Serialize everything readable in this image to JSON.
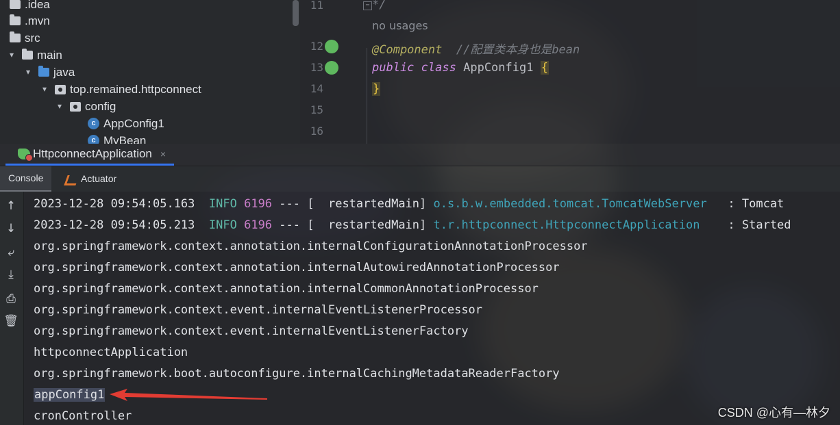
{
  "project_tree": {
    "items": [
      {
        "label": ".idea",
        "type": "folder"
      },
      {
        "label": ".mvn",
        "type": "folder"
      },
      {
        "label": "src",
        "type": "folder"
      },
      {
        "label": "main",
        "type": "folder"
      },
      {
        "label": "java",
        "type": "source-folder"
      },
      {
        "label": "top.remained.httpconnect",
        "type": "package"
      },
      {
        "label": "config",
        "type": "package"
      },
      {
        "label": "AppConfig1",
        "type": "class"
      },
      {
        "label": "MyBean",
        "type": "class"
      }
    ],
    "class_icon_glyph": "c"
  },
  "editor": {
    "line_numbers": [
      "11",
      "12",
      "13",
      "14",
      "15",
      "16"
    ],
    "comment_end": "*/",
    "usages_hint": "no usages",
    "annotation": "@Component",
    "annotation_comment": "//配置类本身也是bean",
    "kw_public": "public",
    "kw_class": "class",
    "class_name": "AppConfig1",
    "open_brace": "{",
    "close_brace": "}"
  },
  "run_panel": {
    "run_tab_label": "HttpconnectApplication",
    "close_glyph": "×",
    "sub_tabs": {
      "console": "Console",
      "actuator": "Actuator"
    }
  },
  "console": {
    "log_entries": [
      {
        "timestamp": "2023-12-28 09:54:05.163",
        "level": "INFO",
        "pid": "6196",
        "separator": "---",
        "thread": "[  restartedMain]",
        "logger": "o.s.b.w.embedded.tomcat.TomcatWebServer",
        "message": "  : Tomcat"
      },
      {
        "timestamp": "2023-12-28 09:54:05.213",
        "level": "INFO",
        "pid": "6196",
        "separator": "---",
        "thread": "[  restartedMain]",
        "logger": "t.r.httpconnect.HttpconnectApplication",
        "message": "   : Started"
      }
    ],
    "plain_lines": [
      "org.springframework.context.annotation.internalConfigurationAnnotationProcessor",
      "org.springframework.context.annotation.internalAutowiredAnnotationProcessor",
      "org.springframework.context.annotation.internalCommonAnnotationProcessor",
      "org.springframework.context.event.internalEventListenerProcessor",
      "org.springframework.context.event.internalEventListenerFactory",
      "httpconnectApplication",
      "org.springframework.boot.autoconfigure.internalCachingMetadataReaderFactory",
      "appConfig1",
      "cronController"
    ]
  },
  "watermark": "CSDN @心有—林夕",
  "colors": {
    "accent_tab": "#3574f0",
    "annotation_arrow": "#e23c33"
  }
}
